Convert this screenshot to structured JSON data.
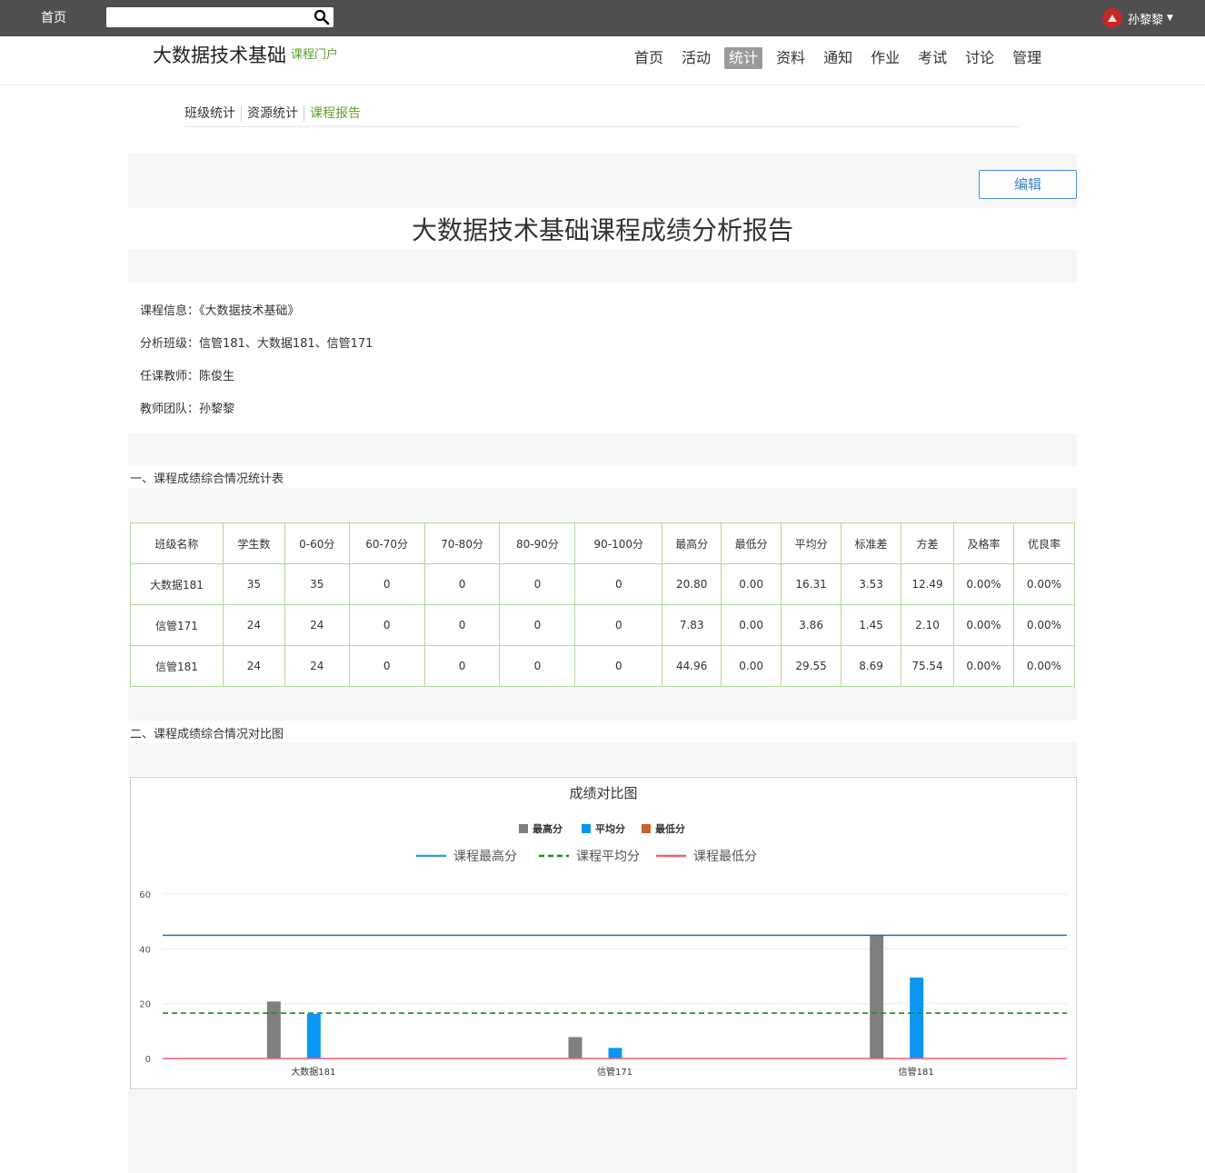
{
  "topbar": {
    "home": "首页",
    "search_placeholder": "",
    "user": "孙黎黎"
  },
  "header": {
    "course_title": "大数据技术基础",
    "portal": "课程门户",
    "nav": [
      "首页",
      "活动",
      "统计",
      "资料",
      "通知",
      "作业",
      "考试",
      "讨论",
      "管理"
    ],
    "active_nav": "统计"
  },
  "subnav": [
    "班级统计",
    "资源统计",
    "课程报告"
  ],
  "edit_label": "编辑",
  "report_title": "大数据技术基础课程成绩分析报告",
  "info": {
    "course": "课程信息：《大数据技术基础》",
    "classes": "分析班级：信管181、大数据181、信管171",
    "teacher": "任课教师：陈俊生",
    "team": "教师团队：孙黎黎"
  },
  "section1": "一、课程成绩综合情况统计表",
  "section2": "二、课程成绩综合情况对比图",
  "table": {
    "headers": [
      "班级名称",
      "学生数",
      "0-60分",
      "60-70分",
      "70-80分",
      "80-90分",
      "90-100分",
      "最高分",
      "最低分",
      "平均分",
      "标准差",
      "方差",
      "及格率",
      "优良率"
    ],
    "rows": [
      [
        "大数据181",
        "35",
        "35",
        "0",
        "0",
        "0",
        "0",
        "20.80",
        "0.00",
        "16.31",
        "3.53",
        "12.49",
        "0.00%",
        "0.00%"
      ],
      [
        "信管171",
        "24",
        "24",
        "0",
        "0",
        "0",
        "0",
        "7.83",
        "0.00",
        "3.86",
        "1.45",
        "2.10",
        "0.00%",
        "0.00%"
      ],
      [
        "信管181",
        "24",
        "24",
        "0",
        "0",
        "0",
        "0",
        "44.96",
        "0.00",
        "29.55",
        "8.69",
        "75.54",
        "0.00%",
        "0.00%"
      ]
    ]
  },
  "chart_data": {
    "type": "bar",
    "title": "成绩对比图",
    "categories": [
      "大数据181",
      "信管171",
      "信管181"
    ],
    "series": [
      {
        "name": "最高分",
        "values": [
          20.8,
          7.83,
          44.96
        ],
        "color": "#7f7f7f"
      },
      {
        "name": "平均分",
        "values": [
          16.31,
          3.86,
          29.55
        ],
        "color": "#0a96f5"
      },
      {
        "name": "最低分",
        "values": [
          0.0,
          0.0,
          0.0
        ],
        "color": "#c8622e"
      }
    ],
    "lines": [
      {
        "name": "课程最高分",
        "value": 44.96,
        "color": "#2f6bb5",
        "legend_color": "#3a9cc5",
        "dash": false
      },
      {
        "name": "课程平均分",
        "value": 16.57,
        "color": "#1f8a1f",
        "dash": true
      },
      {
        "name": "课程最低分",
        "value": 0,
        "color": "#e8607a",
        "dash": false
      }
    ],
    "ylim": [
      0,
      60
    ],
    "yticks": [
      0,
      20,
      40,
      60
    ],
    "grid": true,
    "legend_position": "top-center"
  }
}
